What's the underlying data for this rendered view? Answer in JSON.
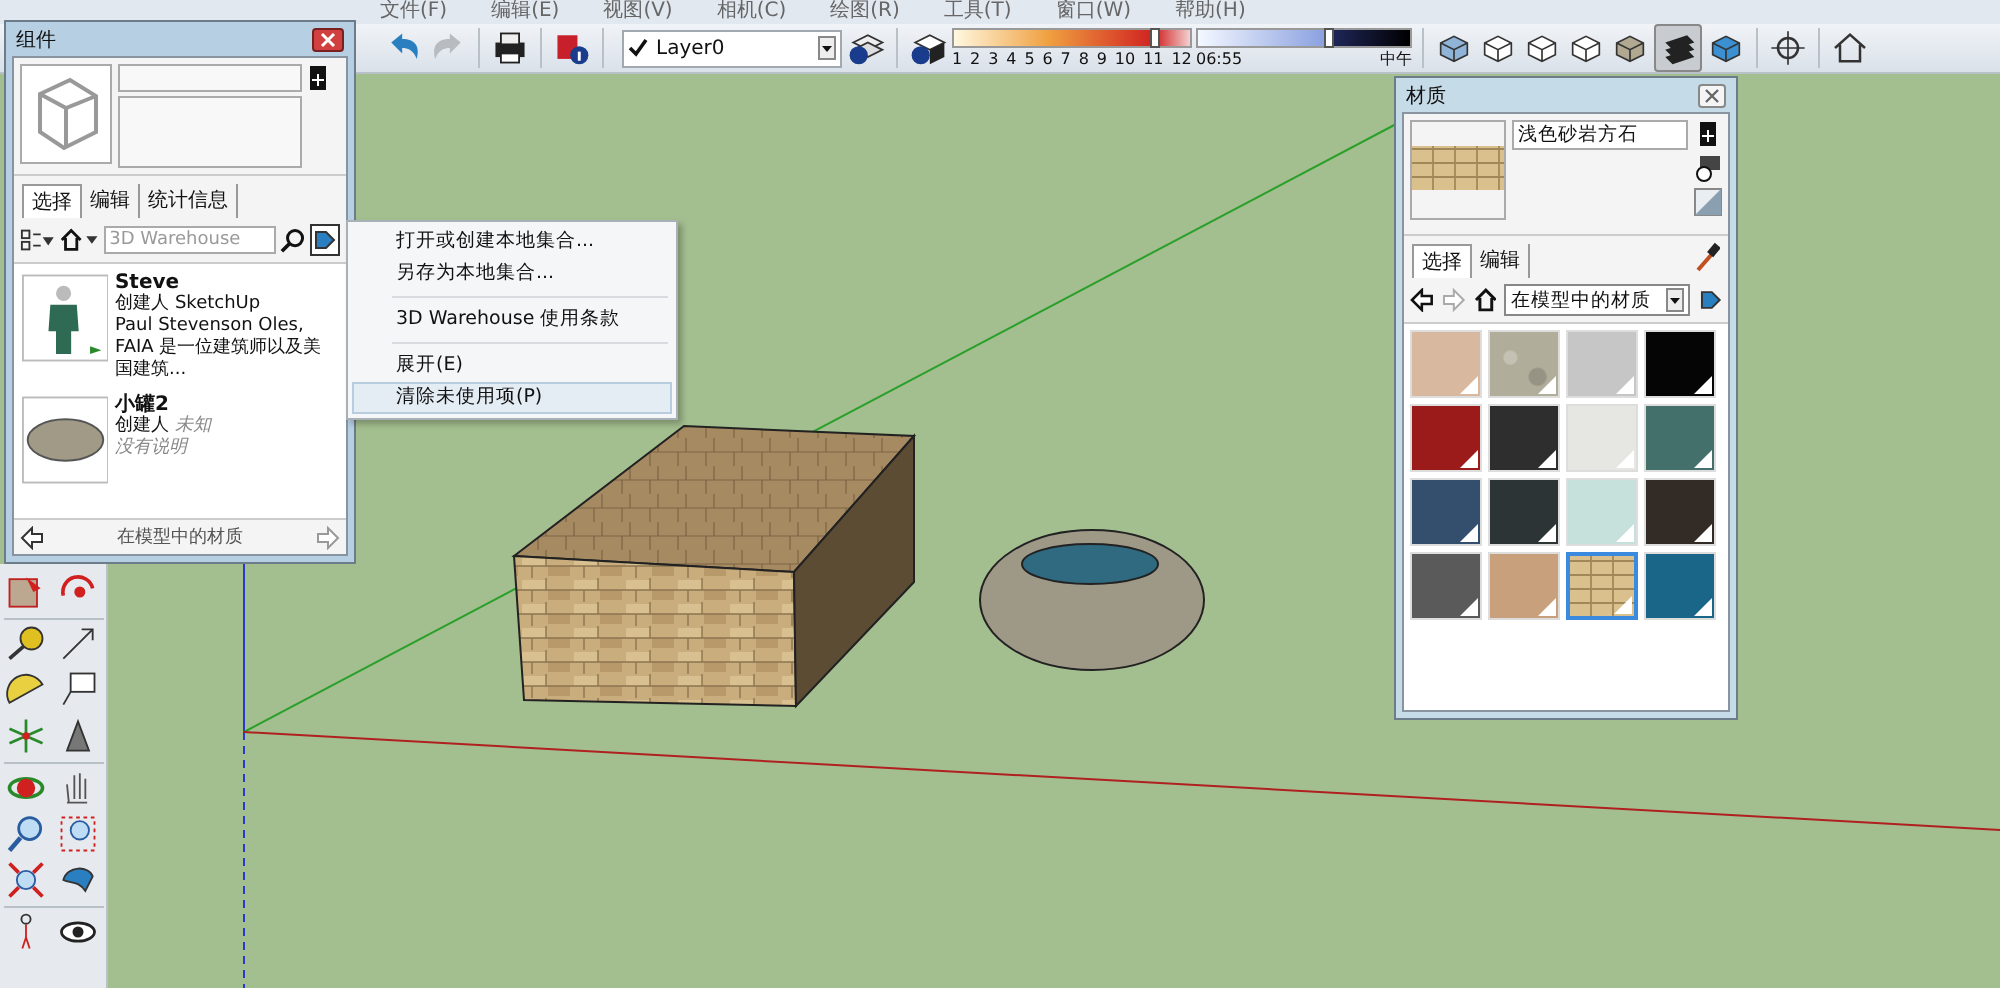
{
  "menu_bar": [
    "文件(F)",
    "编辑(E)",
    "视图(V)",
    "相机(C)",
    "绘图(R)",
    "工具(T)",
    "窗口(W)",
    "帮助(H)"
  ],
  "toolbar": {
    "layer": {
      "name": "Layer0",
      "checked": true
    },
    "month_slider": {
      "labels": [
        "1",
        "2",
        "3",
        "4",
        "5",
        "6",
        "7",
        "8",
        "9",
        "10",
        "11",
        "12"
      ],
      "level": 0.84
    },
    "time_slider": {
      "labels": [
        "06:55",
        "中午"
      ],
      "level": 0.6
    }
  },
  "components_panel": {
    "title": "组件",
    "tabs": [
      {
        "label": "选择",
        "selected": true
      },
      {
        "label": "编辑",
        "selected": false
      },
      {
        "label": "统计信息",
        "selected": false
      }
    ],
    "search": {
      "placeholder": "3D Warehouse"
    },
    "items": [
      {
        "kind": "person",
        "name": "Steve",
        "creator_label": "创建人",
        "creator": "SketchUp",
        "creator_known": true,
        "description": "Paul Stevenson Oles, FAIA 是一位建筑师以及美国建筑..."
      },
      {
        "kind": "bowl",
        "name": "小罐2",
        "creator_label": "创建人",
        "creator": "未知",
        "creator_known": false,
        "description": "没有说明"
      }
    ],
    "footer": "在模型中的材质"
  },
  "context_menu": {
    "groups": [
      [
        {
          "label": "打开或创建本地集合...",
          "selected": false
        },
        {
          "label": "另存为本地集合...",
          "selected": false
        }
      ],
      [
        {
          "label": "3D Warehouse 使用条款",
          "selected": false
        }
      ],
      [
        {
          "label": "展开(E)",
          "selected": false
        },
        {
          "label": "清除未使用项(P)",
          "selected": true
        }
      ]
    ]
  },
  "materials_panel": {
    "title": "材质",
    "material_name": "浅色砂岩方石",
    "tabs": [
      {
        "label": "选择",
        "selected": true
      },
      {
        "label": "编辑",
        "selected": false
      }
    ],
    "collection": "在模型中的材质",
    "swatches": [
      {
        "kind": "color",
        "color": "#d8b89e",
        "selected": false
      },
      {
        "kind": "stone",
        "color": "#b1ad9b",
        "selected": false
      },
      {
        "kind": "color",
        "color": "#c6c6c6",
        "selected": false
      },
      {
        "kind": "color",
        "color": "#050505",
        "selected": false
      },
      {
        "kind": "color",
        "color": "#9b1b1b",
        "selected": false
      },
      {
        "kind": "color",
        "color": "#2e2e2e",
        "selected": false
      },
      {
        "kind": "color",
        "color": "#e6e6e2",
        "selected": false
      },
      {
        "kind": "color",
        "color": "#44706c",
        "selected": false
      },
      {
        "kind": "color",
        "color": "#344e6e",
        "selected": false
      },
      {
        "kind": "color",
        "color": "#2c3436",
        "selected": false
      },
      {
        "kind": "color",
        "color": "#c6e0dc",
        "selected": false
      },
      {
        "kind": "color",
        "color": "#332c26",
        "selected": false
      },
      {
        "kind": "color",
        "color": "#5a5a5a",
        "selected": false
      },
      {
        "kind": "color",
        "color": "#c8a07c",
        "selected": false
      },
      {
        "kind": "sandstone",
        "color": "#d9c08c",
        "selected": true
      },
      {
        "kind": "color",
        "color": "#1a6688",
        "selected": false
      }
    ]
  }
}
